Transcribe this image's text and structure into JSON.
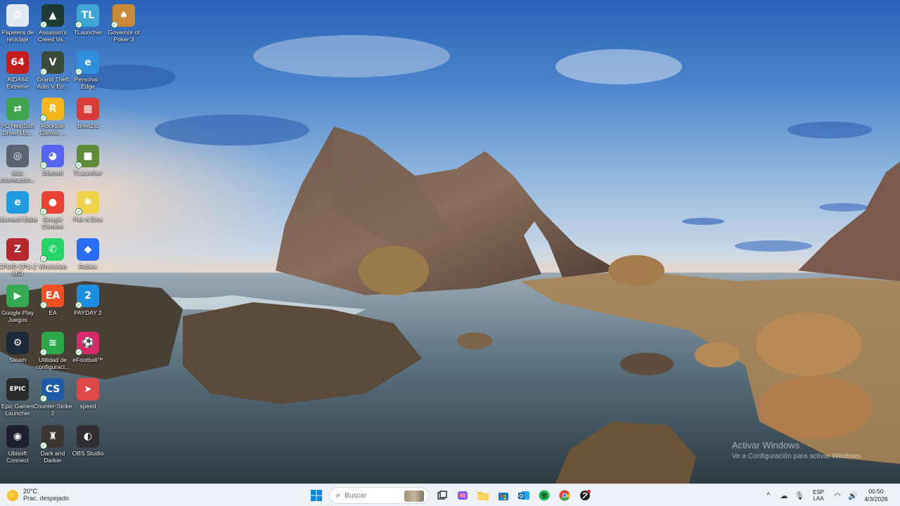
{
  "desktop": {
    "icons": [
      {
        "label": "Papelera de reciclaje",
        "icon": "recycle-bin-icon",
        "color": "#dfe9f3",
        "glyph": "♻",
        "check": false
      },
      {
        "label": "Assassin's Creed Va...",
        "icon": "assassins-creed-icon",
        "color": "#1d3a33",
        "glyph": "▲",
        "check": true
      },
      {
        "label": "TLauncher",
        "icon": "tlauncher-icon",
        "color": "#3ea7d6",
        "glyph": "TL",
        "check": true
      },
      {
        "label": "Governor of Poker 3",
        "icon": "governor-of-poker-icon",
        "color": "#c98a35",
        "glyph": "♠",
        "check": true
      },
      {
        "label": "AIDA64 Extreme",
        "icon": "aida64-icon",
        "color": "#c41d1d",
        "glyph": "64",
        "check": false
      },
      {
        "label": "Grand Theft Auto V En...",
        "icon": "gta-v-icon",
        "color": "#3c4a3a",
        "glyph": "V",
        "check": true
      },
      {
        "label": "Personal - Edge",
        "icon": "edge-personal-icon",
        "color": "#2f8fdc",
        "glyph": "e",
        "check": true
      },
      {
        "label": "PC HelpSoft Driver Up...",
        "icon": "pc-helpsoft-icon",
        "color": "#3fa34d",
        "glyph": "⇄",
        "check": false
      },
      {
        "label": "Rockstar Games ...",
        "icon": "rockstar-icon",
        "color": "#f2b619",
        "glyph": "R",
        "check": true
      },
      {
        "label": "BreeZip",
        "icon": "breezip-icon",
        "color": "#d93a3a",
        "glyph": "▦",
        "check": false
      },
      {
        "label": "Más información...",
        "icon": "more-info-icon",
        "color": "#5a6470",
        "glyph": "◎",
        "check": false
      },
      {
        "label": "Discord",
        "icon": "discord-icon",
        "color": "#5865f2",
        "glyph": "◕",
        "check": true
      },
      {
        "label": "TLauncher",
        "icon": "minecraft-icon",
        "color": "#5f8a3a",
        "glyph": "■",
        "check": true
      },
      {
        "label": "Microsoft Edge",
        "icon": "microsoft-edge-icon",
        "color": "#1f9de0",
        "glyph": "e",
        "check": false
      },
      {
        "label": "Google Chrome",
        "icon": "google-chrome-icon",
        "color": "#e94235",
        "glyph": "●",
        "check": true
      },
      {
        "label": "Pair A Dice",
        "icon": "pair-a-dice-icon",
        "color": "#f1d04a",
        "glyph": "✱",
        "check": true
      },
      {
        "label": "CPUID CPU-Z MSI",
        "icon": "cpuz-icon",
        "color": "#b5282e",
        "glyph": "Z",
        "check": false
      },
      {
        "label": "WhatsApp",
        "icon": "whatsapp-icon",
        "color": "#25d366",
        "glyph": "✆",
        "check": true
      },
      {
        "label": "Roblox",
        "icon": "roblox-icon",
        "color": "#2b6cf5",
        "glyph": "◆",
        "check": false
      },
      {
        "label": "Google Play Juegos",
        "icon": "google-play-games-icon",
        "color": "#34a853",
        "glyph": "▶",
        "check": false
      },
      {
        "label": "EA",
        "icon": "ea-icon",
        "color": "#f05023",
        "glyph": "EA",
        "check": true
      },
      {
        "label": "PAYDAY 2",
        "icon": "payday2-icon",
        "color": "#1c8ee0",
        "glyph": "2",
        "check": true
      },
      {
        "label": "Steam",
        "icon": "steam-icon",
        "color": "#1b2838",
        "glyph": "⚙",
        "check": false
      },
      {
        "label": "Utilidad de configuraci...",
        "icon": "config-utility-icon",
        "color": "#2aa84a",
        "glyph": "≋",
        "check": true
      },
      {
        "label": "eFootball™",
        "icon": "efootball-icon",
        "color": "#d62a6a",
        "glyph": "⚽",
        "check": true
      },
      {
        "label": "Epic Games Launcher",
        "icon": "epic-games-icon",
        "color": "#2a2a2a",
        "glyph": "EPIC",
        "check": false
      },
      {
        "label": "Counter-Strike 2",
        "icon": "counter-strike-icon",
        "color": "#1f5aa8",
        "glyph": "CS",
        "check": true
      },
      {
        "label": "speed",
        "icon": "speed-icon",
        "color": "#e04848",
        "glyph": "➤",
        "check": false
      },
      {
        "label": "Ubisoft Connect",
        "icon": "ubisoft-icon",
        "color": "#1e1e2e",
        "glyph": "◉",
        "check": false
      },
      {
        "label": "Dark and Darker",
        "icon": "dark-and-darker-icon",
        "color": "#3b3631",
        "glyph": "♜",
        "check": true
      },
      {
        "label": "OBS Studio",
        "icon": "obs-studio-icon",
        "color": "#302e31",
        "glyph": "◐",
        "check": false
      }
    ]
  },
  "watermark": {
    "title": "Activar Windows",
    "subtitle": "Ve a Configuración para activar Windows."
  },
  "taskbar": {
    "weather": {
      "temp": "20°C",
      "condition": "Prac. despejado",
      "icon": "sun-icon"
    },
    "search": {
      "placeholder": "Buscar"
    },
    "apps": [
      {
        "icon": "windows-start-icon",
        "color": "#0078d4"
      },
      {
        "icon": "task-view-icon",
        "color": "#2b2b2b"
      },
      {
        "icon": "copilot-store-icon",
        "color": "#7b5cf0"
      },
      {
        "icon": "file-explorer-icon",
        "color": "#f5c242"
      },
      {
        "icon": "microsoft-store-icon",
        "color": "#1a73c9"
      },
      {
        "icon": "outlook-icon",
        "color": "#0a64ad"
      },
      {
        "icon": "spotify-icon",
        "color": "#1db954"
      },
      {
        "icon": "chrome-taskbar-icon",
        "color": "#e94235"
      },
      {
        "icon": "app-with-badge-icon",
        "color": "#222222"
      }
    ],
    "tray": {
      "lang_line1": "ESP",
      "lang_line2": "LAA",
      "time": "00:50",
      "date": "4/3/2026"
    }
  }
}
